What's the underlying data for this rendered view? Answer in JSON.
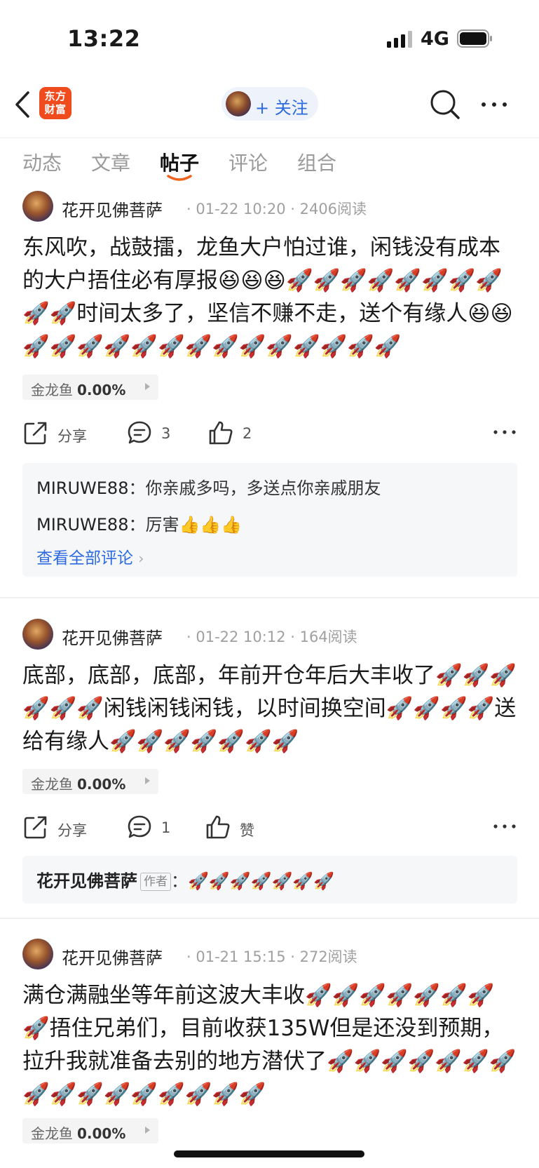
{
  "status_bar": {
    "time": "13:22",
    "network": "4G"
  },
  "nav": {
    "app_logo_line1": "东方",
    "app_logo_line2": "财富",
    "follow_label": "+ 关注"
  },
  "tabs": [
    "动态",
    "文章",
    "帖子",
    "评论",
    "组合"
  ],
  "active_tab": "帖子",
  "posts": [
    {
      "author": "花开见佛菩萨",
      "meta": "· 01-22 10:20 · 2406阅读",
      "body": "东风吹，战鼓擂，龙鱼大户怕过谁，闲钱没有成本的大户捂住必有厚报😆😆😆🚀🚀🚀🚀🚀🚀🚀🚀🚀🚀时间太多了，坚信不赚不走，送个有缘人😆😆🚀🚀🚀🚀🚀🚀🚀🚀🚀🚀🚀🚀🚀🚀",
      "stock": {
        "name": "金龙鱼",
        "change": "0.00%"
      },
      "share": "分享",
      "comments_count": "3",
      "likes": "2",
      "comments": [
        {
          "user": "MIRUWE88",
          "text": "你亲戚多吗，多送点你亲戚朋友"
        },
        {
          "user": "MIRUWE88",
          "text": "厉害👍👍👍"
        }
      ],
      "view_all": "查看全部评论"
    },
    {
      "author": "花开见佛菩萨",
      "meta": "· 01-22 10:12 · 164阅读",
      "body": "底部，底部，底部，年前开仓年后大丰收了🚀🚀🚀🚀🚀🚀闲钱闲钱闲钱，以时间换空间🚀🚀🚀🚀送给有缘人🚀🚀🚀🚀🚀🚀🚀",
      "stock": {
        "name": "金龙鱼",
        "change": "0.00%"
      },
      "share": "分享",
      "comments_count": "1",
      "likes": "赞",
      "author_reply": {
        "user": "花开见佛菩萨",
        "badge": "作者",
        "text": "🚀🚀🚀🚀🚀🚀🚀"
      }
    },
    {
      "author": "花开见佛菩萨",
      "meta": "· 01-21 15:15 · 272阅读",
      "body": "满仓满融坐等年前这波大丰收🚀🚀🚀🚀🚀🚀🚀🚀捂住兄弟们，目前收获135W但是还没到预期，拉升我就准备去别的地方潜伏了🚀🚀🚀🚀🚀🚀🚀🚀🚀🚀🚀🚀🚀🚀🚀🚀",
      "stock": {
        "name": "金龙鱼",
        "change": "0.00%"
      }
    }
  ],
  "colors": {
    "accent_blue": "#2d6ae0",
    "brand_orange": "#f04b1c"
  }
}
